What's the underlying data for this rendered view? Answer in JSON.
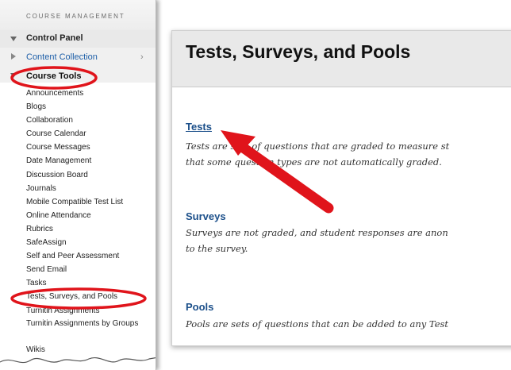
{
  "sidebar": {
    "section_header": "COURSE MANAGEMENT",
    "control_panel": "Control Panel",
    "content_collection": "Content Collection",
    "content_collection_chevron": "›",
    "course_tools": "Course Tools",
    "tools": [
      "Announcements",
      "Blogs",
      "Collaboration",
      "Course Calendar",
      "Course Messages",
      "Date Management",
      "Discussion Board",
      "Journals",
      "Mobile Compatible Test List",
      "Online Attendance",
      "Rubrics",
      "SafeAssign",
      "Self and Peer Assessment",
      "Send Email",
      "Tasks",
      "Tests, Surveys, and Pools",
      "Turnitin Assignments",
      "Turnitin Assignments by Groups",
      "Wikis"
    ]
  },
  "page": {
    "title": "Tests, Surveys, and Pools",
    "tests": {
      "label": "Tests",
      "description": "Tests are sets of questions that are graded to measure st",
      "description_line2": "that some question types are not automatically graded."
    },
    "surveys": {
      "label": "Surveys",
      "description": "Surveys are not graded, and student responses are anon",
      "description_line2": "to the survey."
    },
    "pools": {
      "label": "Pools",
      "description": "Pools are sets of questions that can be added to any Test"
    }
  },
  "annotations": {
    "highlight_color": "#e0141b",
    "arrow_color": "#e0141b"
  },
  "colors": {
    "link_blue": "#1b4f8a",
    "nav_link_blue": "#1e5fa8",
    "header_gray": "#e9e9e9"
  }
}
